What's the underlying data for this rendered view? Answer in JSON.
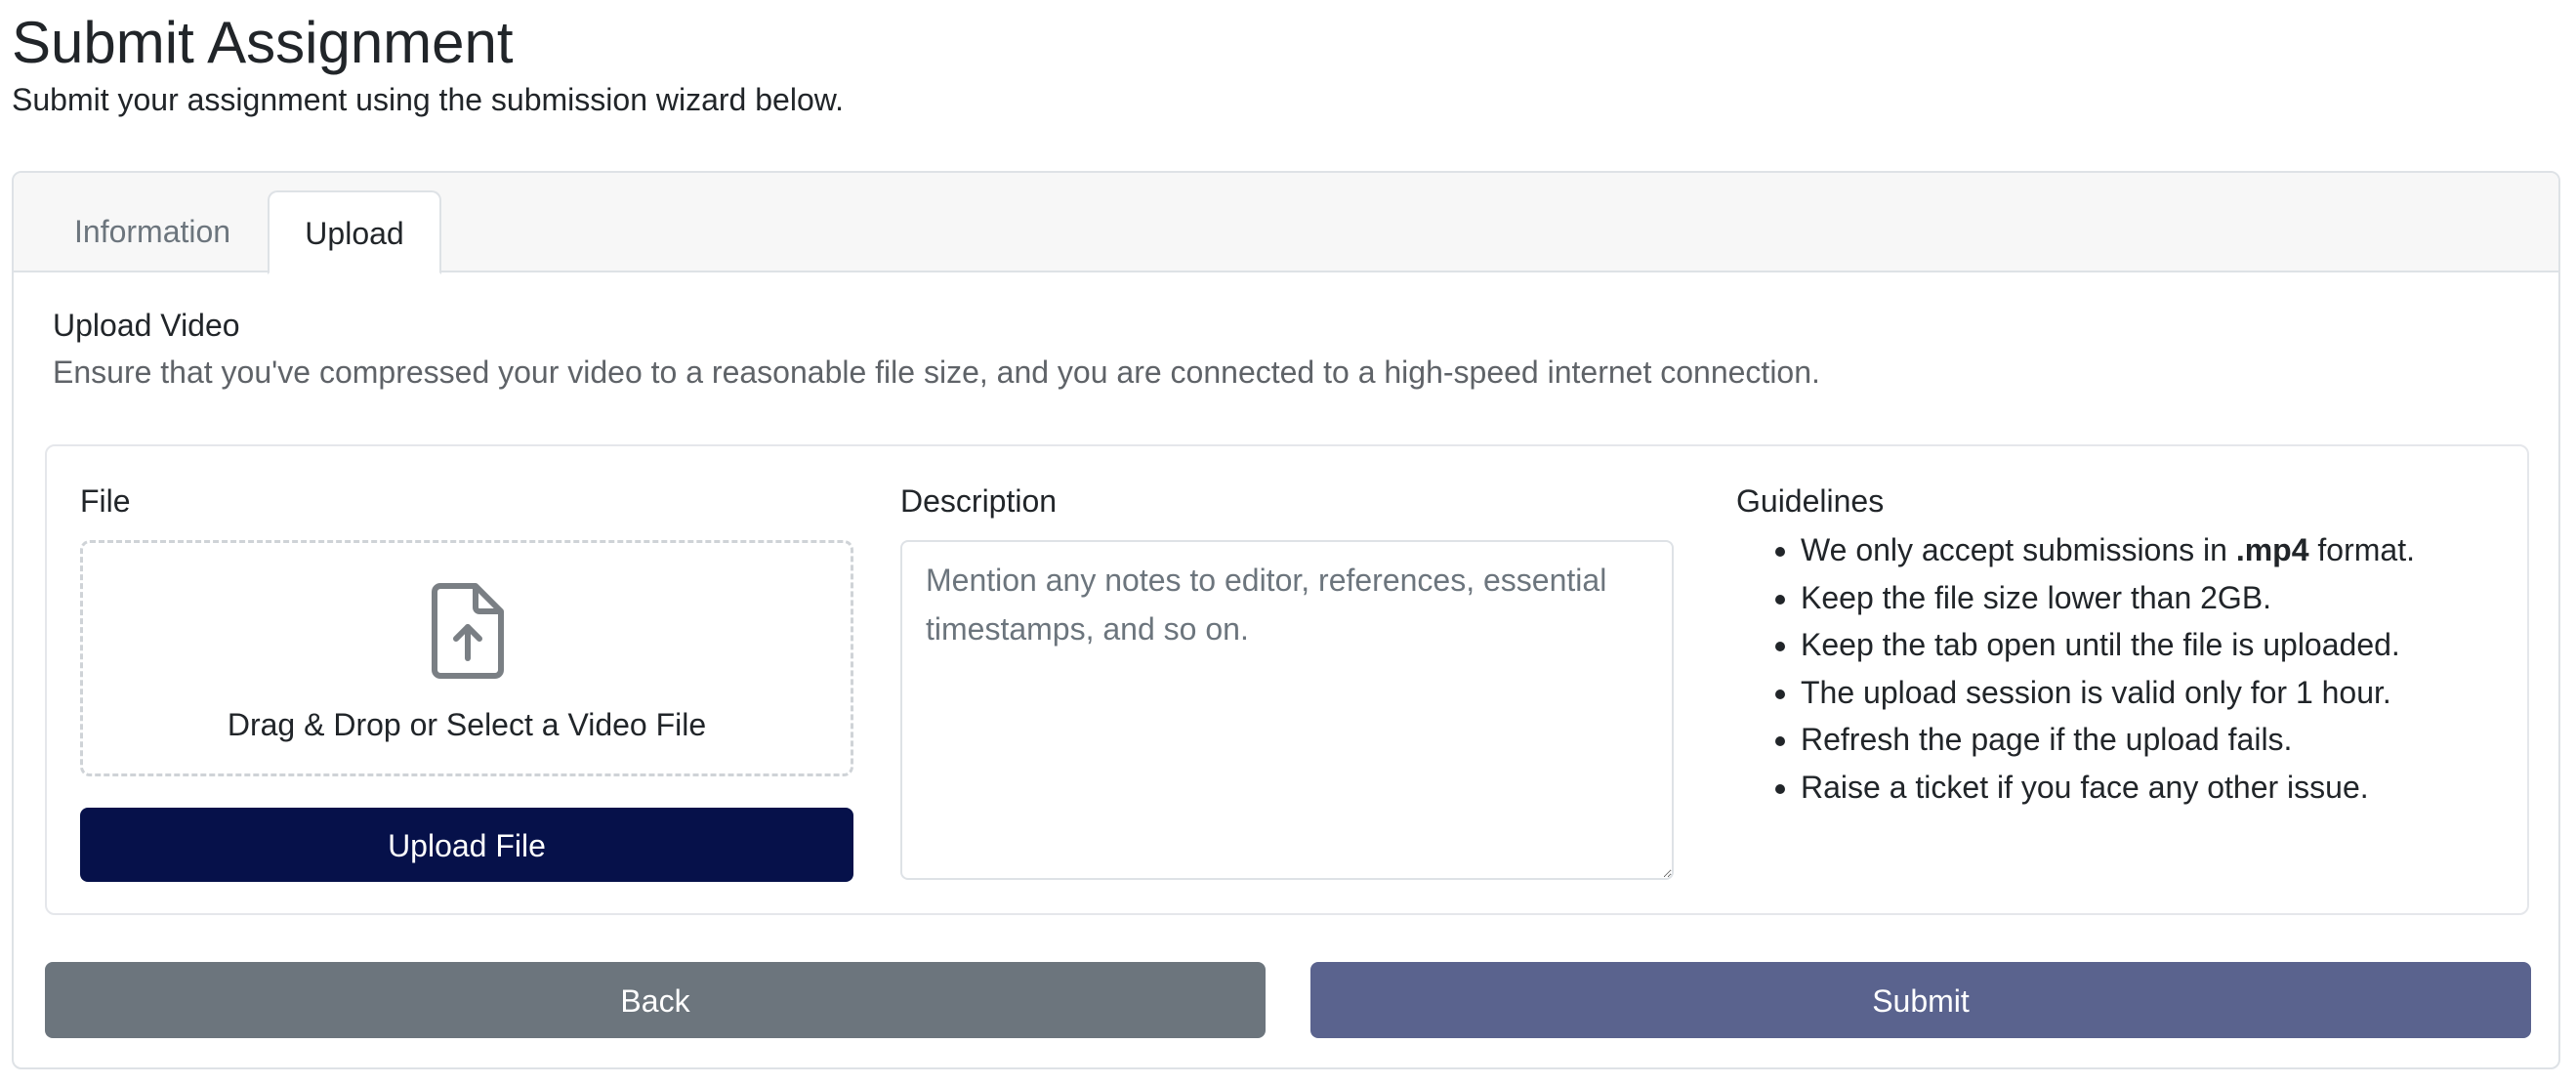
{
  "page": {
    "title": "Submit Assignment",
    "subtitle": "Submit your assignment using the submission wizard below."
  },
  "tabs": [
    {
      "label": "Information",
      "active": false
    },
    {
      "label": "Upload",
      "active": true
    }
  ],
  "upload_section": {
    "title": "Upload Video",
    "description": "Ensure that you've compressed your video to a reasonable file size, and you are connected to a high-speed internet connection."
  },
  "file": {
    "label": "File",
    "dropzone_icon": "file-upload-icon",
    "dropzone_text": "Drag & Drop or Select a Video File",
    "upload_button": "Upload File"
  },
  "description": {
    "label": "Description",
    "value": "",
    "placeholder": "Mention any notes to editor, references, essential timestamps, and so on."
  },
  "guidelines": {
    "label": "Guidelines",
    "items": [
      {
        "before": "We only accept submissions in ",
        "bold": ".mp4",
        "after": " format."
      },
      {
        "text": "Keep the file size lower than 2GB."
      },
      {
        "text": "Keep the tab open until the file is uploaded."
      },
      {
        "text": "The upload session is valid only for 1 hour."
      },
      {
        "text": "Refresh the page if the upload fails."
      },
      {
        "text": "Raise a ticket if you face any other issue."
      }
    ]
  },
  "actions": {
    "back_label": "Back",
    "submit_label": "Submit"
  },
  "colors": {
    "upload_button": "#06114a",
    "back_button": "#6c757d",
    "submit_button": "#5a638e"
  }
}
